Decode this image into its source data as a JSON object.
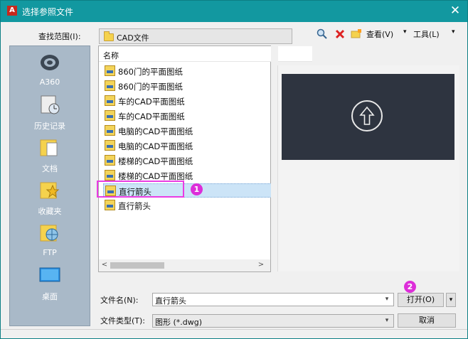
{
  "window": {
    "title": "选择参照文件",
    "close_glyph": "✕",
    "title_icon_glyph": "A"
  },
  "lookin": {
    "label": "查找范围(I):",
    "value": "CAD文件"
  },
  "toolbar": {
    "view_label": "查看(V)",
    "tools_label": "工具(L)",
    "view_arrow": "▾",
    "tools_arrow": "▾",
    "more_arrow": "▾"
  },
  "sidebar": {
    "items": [
      {
        "label": "A360",
        "icon": "a360-icon"
      },
      {
        "label": "历史记录",
        "icon": "history-icon"
      },
      {
        "label": "文档",
        "icon": "documents-icon"
      },
      {
        "label": "收藏夹",
        "icon": "favorites-icon"
      },
      {
        "label": "FTP",
        "icon": "ftp-icon"
      },
      {
        "label": "桌面",
        "icon": "desktop-icon"
      }
    ]
  },
  "filelist": {
    "column_header": "名称",
    "files": [
      {
        "name": "860门的平面图纸"
      },
      {
        "name": "860门的平面图纸"
      },
      {
        "name": "车的CAD平面图纸"
      },
      {
        "name": "车的CAD平面图纸"
      },
      {
        "name": "电脑的CAD平面图纸"
      },
      {
        "name": "电脑的CAD平面图纸"
      },
      {
        "name": "楼梯的CAD平面图纸"
      },
      {
        "name": "楼梯的CAD平面图纸"
      },
      {
        "name": "直行箭头",
        "selected": true
      },
      {
        "name": "直行箭头"
      }
    ],
    "scroll_left": "<",
    "scroll_right": ">"
  },
  "filename": {
    "label": "文件名(N):",
    "value": "直行箭头",
    "arrow": "▾"
  },
  "filetype": {
    "label": "文件类型(T):",
    "value": "图形 (*.dwg)",
    "arrow": "▾"
  },
  "buttons": {
    "open": "打开(O)",
    "open_arrow": "▾",
    "cancel": "取消"
  },
  "annotations": {
    "badge1": "1",
    "badge2": "2"
  },
  "colors": {
    "titlebar": "#1298a0",
    "highlight": "#ea3ce3",
    "sidebar": "#a9b9c8"
  }
}
